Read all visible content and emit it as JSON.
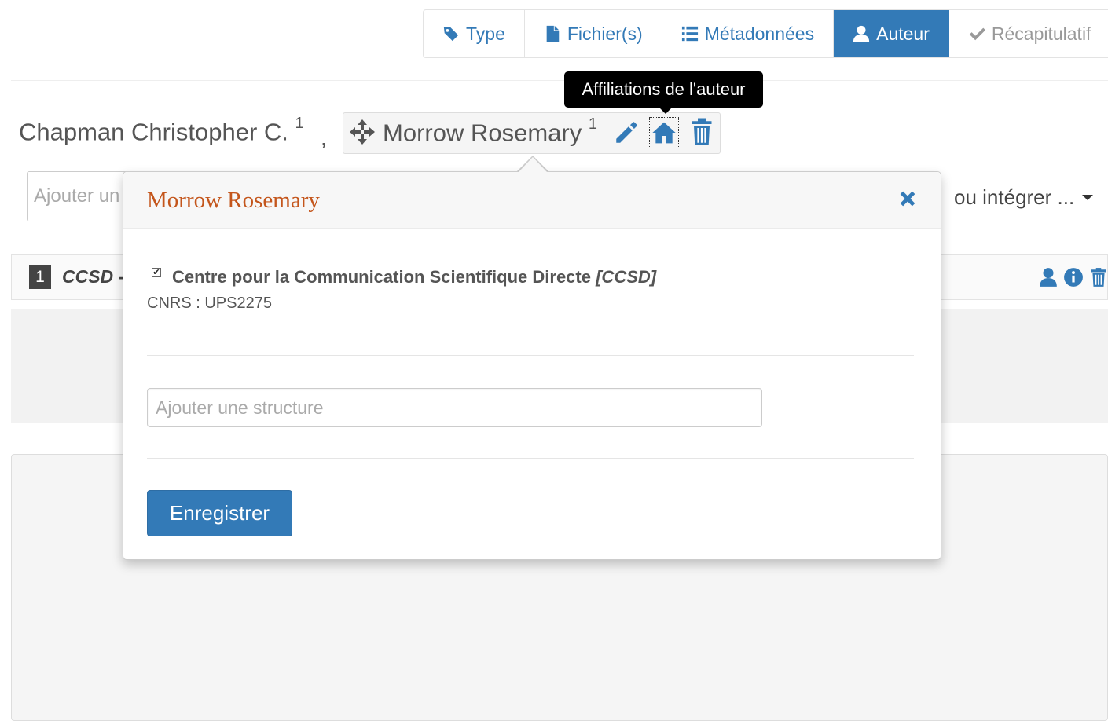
{
  "tabs": [
    {
      "label": "Type",
      "icon": "tag-icon"
    },
    {
      "label": "Fichier(s)",
      "icon": "file-icon"
    },
    {
      "label": "Métadonnées",
      "icon": "list-icon"
    },
    {
      "label": "Auteur",
      "icon": "user-icon",
      "active": true
    },
    {
      "label": "Récapitulatif",
      "icon": "check-icon",
      "disabled": true
    }
  ],
  "tooltip": {
    "text": "Affiliations de l'auteur"
  },
  "authors": [
    {
      "name": "Chapman Christopher C.",
      "affiliation_num": "1",
      "separator": ","
    },
    {
      "name": "Morrow Rosemary",
      "affiliation_num": "1"
    }
  ],
  "background": {
    "add_author_placeholder": "Ajouter un",
    "integrate_label": "ou intégrer ...",
    "structure_row": {
      "number": "1",
      "code": "CCSD -"
    }
  },
  "popover": {
    "title": "Morrow Rosemary",
    "affiliation": {
      "checked": true,
      "name": "Centre pour la Communication Scientifique Directe",
      "acronym": "[CCSD]",
      "sub": "CNRS : UPS2275"
    },
    "structure_placeholder": "Ajouter une structure",
    "save_label": "Enregistrer"
  },
  "colors": {
    "primary": "#337ab7",
    "title_orange": "#c4561c",
    "tooltip_bg": "#000000"
  }
}
